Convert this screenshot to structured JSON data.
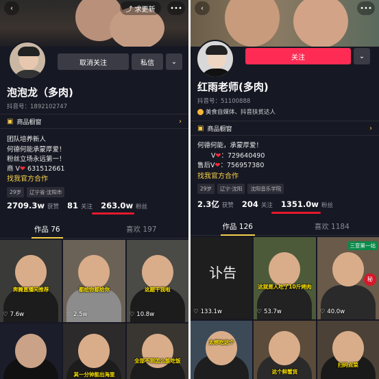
{
  "left": {
    "update_label": "求更新",
    "unfollow_label": "取消关注",
    "message_label": "私信",
    "name": "泡泡龙（多肉)",
    "douyin_id": "抖音号：1892102747",
    "shop_label": "商品橱窗",
    "bio": [
      "团队培养新人",
      "何德何能承蒙厚爱！",
      "粉丝立场永远第一！",
      "商 V",
      "631512661"
    ],
    "official_link": "找我官方合作",
    "tags": [
      "29岁",
      "辽宁省·沈阳市"
    ],
    "stats": {
      "likes_num": "2709.3w",
      "likes_label": "获赞",
      "following_num": "81",
      "following_label": "关注",
      "fans_num": "263.0w",
      "fans_label": "粉丝"
    },
    "tabs": {
      "works": "作品 76",
      "likes": "喜欢 197"
    },
    "videos": [
      {
        "caption": "奔腾直播间推荐",
        "plays": "7.6w"
      },
      {
        "caption": "都给你都给你",
        "plays": "2.5w"
      },
      {
        "caption": "这题干我啦",
        "plays": "10.8w"
      },
      {
        "caption": "",
        "plays": ""
      },
      {
        "caption": "其一分钟能出海里",
        "plays": ""
      },
      {
        "caption": "全部不到怎么能吃饭",
        "plays": ""
      }
    ]
  },
  "right": {
    "follow_label": "关注",
    "name": "红雨老师(多肉)",
    "douyin_id": "抖音号：51100888",
    "verified": "美食自媒体、抖音扶贫达人",
    "shop_label": "商品橱窗",
    "bio": [
      "何德何能，承蒙厚爱！",
      "V",
      "：729640490",
      "售后V",
      "：756957380"
    ],
    "official_link": "找我官方合作",
    "tags": [
      "29岁",
      "辽宁·沈阳",
      "沈阳音乐学院"
    ],
    "stats": {
      "likes_num": "2.3亿",
      "likes_label": "获赞",
      "following_num": "204",
      "following_label": "关注",
      "fans_num": "1351.0w",
      "fans_label": "粉丝"
    },
    "tabs": {
      "works": "作品 126",
      "likes": "喜欢 1184"
    },
    "videos": [
      {
        "caption": "讣告",
        "plays": "133.1w"
      },
      {
        "caption": "这就是人吃了10斤烤肉的感觉",
        "plays": "53.7w"
      },
      {
        "caption": "三亚第一站",
        "plays": "40.0w"
      },
      {
        "caption": "太想吃这个",
        "plays": ""
      },
      {
        "caption": "这个鲜蟹货",
        "plays": ""
      },
      {
        "caption": "扫码点菜",
        "plays": ""
      }
    ]
  },
  "icons": {
    "back": "‹",
    "more": "•••",
    "share": "⤴",
    "chevron": "›",
    "dropdown": "⌄",
    "heart_outline": "♡",
    "heart": "❤",
    "cart": "▣"
  },
  "colors": {
    "accent_red": "#fe2c55",
    "link_yellow": "#f7d14a",
    "bg": "#161823",
    "highlight": "#e8192c"
  }
}
